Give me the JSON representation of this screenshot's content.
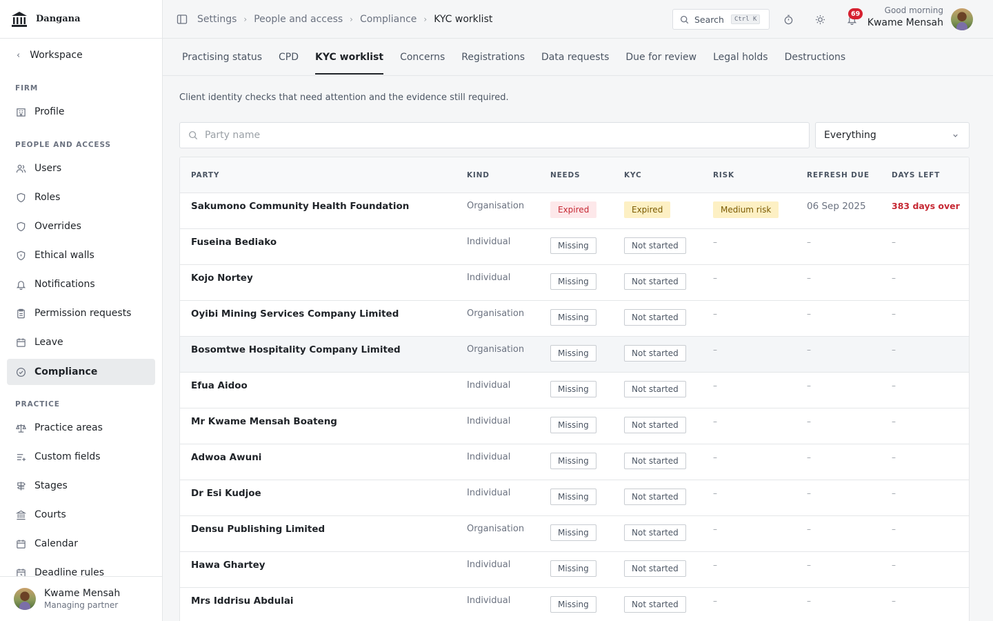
{
  "brand": {
    "name": "Dangana"
  },
  "sidebar": {
    "back_label": "Workspace",
    "sections": [
      {
        "label": "FIRM",
        "items": [
          {
            "label": "Profile",
            "icon": "building-icon"
          }
        ]
      },
      {
        "label": "PEOPLE AND ACCESS",
        "items": [
          {
            "label": "Users",
            "icon": "users-icon"
          },
          {
            "label": "Roles",
            "icon": "shield-icon"
          },
          {
            "label": "Overrides",
            "icon": "shield-icon"
          },
          {
            "label": "Ethical walls",
            "icon": "shield-lock-icon"
          },
          {
            "label": "Notifications",
            "icon": "bell-icon"
          },
          {
            "label": "Permission requests",
            "icon": "clipboard-icon"
          },
          {
            "label": "Leave",
            "icon": "calendar-icon"
          },
          {
            "label": "Compliance",
            "icon": "check-circle-icon",
            "active": true
          }
        ]
      },
      {
        "label": "PRACTICE",
        "items": [
          {
            "label": "Practice areas",
            "icon": "scales-icon"
          },
          {
            "label": "Custom fields",
            "icon": "list-plus-icon"
          },
          {
            "label": "Stages",
            "icon": "signpost-icon"
          },
          {
            "label": "Courts",
            "icon": "landmark-icon"
          },
          {
            "label": "Calendar",
            "icon": "calendar-icon"
          },
          {
            "label": "Deadline rules",
            "icon": "calendar-clock-icon"
          }
        ]
      }
    ],
    "user": {
      "name": "Kwame Mensah",
      "role": "Managing partner"
    }
  },
  "header": {
    "breadcrumb": [
      "Settings",
      "People and access",
      "Compliance",
      "KYC worklist"
    ],
    "search_label": "Search",
    "search_shortcut": "Ctrl K",
    "notification_count": "69",
    "greeting": "Good morning",
    "user_name": "Kwame Mensah"
  },
  "tabs": [
    "Practising status",
    "CPD",
    "KYC worklist",
    "Concerns",
    "Registrations",
    "Data requests",
    "Due for review",
    "Legal holds",
    "Destructions"
  ],
  "active_tab": "KYC worklist",
  "description": "Client identity checks that need attention and the evidence still required.",
  "filters": {
    "search_placeholder": "Party name",
    "scope_value": "Everything"
  },
  "table": {
    "columns": [
      "PARTY",
      "KIND",
      "NEEDS",
      "KYC",
      "RISK",
      "REFRESH DUE",
      "DAYS LEFT"
    ],
    "rows": [
      {
        "party": "Sakumono Community Health Foundation",
        "kind": "Organisation",
        "needs": "Expired",
        "kyc": "Expired",
        "risk": "Medium risk",
        "refresh_due": "06 Sep 2025",
        "days_left": "383 days over"
      },
      {
        "party": "Fuseina Bediako",
        "kind": "Individual",
        "needs": "Missing",
        "kyc": "Not started",
        "risk": "–",
        "refresh_due": "–",
        "days_left": "–"
      },
      {
        "party": "Kojo Nortey",
        "kind": "Individual",
        "needs": "Missing",
        "kyc": "Not started",
        "risk": "–",
        "refresh_due": "–",
        "days_left": "–"
      },
      {
        "party": "Oyibi Mining Services Company Limited",
        "kind": "Organisation",
        "needs": "Missing",
        "kyc": "Not started",
        "risk": "–",
        "refresh_due": "–",
        "days_left": "–"
      },
      {
        "party": "Bosomtwe Hospitality Company Limited",
        "kind": "Organisation",
        "needs": "Missing",
        "kyc": "Not started",
        "risk": "–",
        "refresh_due": "–",
        "days_left": "–"
      },
      {
        "party": "Efua Aidoo",
        "kind": "Individual",
        "needs": "Missing",
        "kyc": "Not started",
        "risk": "–",
        "refresh_due": "–",
        "days_left": "–"
      },
      {
        "party": "Mr Kwame Mensah Boateng",
        "kind": "Individual",
        "needs": "Missing",
        "kyc": "Not started",
        "risk": "–",
        "refresh_due": "–",
        "days_left": "–"
      },
      {
        "party": "Adwoa Awuni",
        "kind": "Individual",
        "needs": "Missing",
        "kyc": "Not started",
        "risk": "–",
        "refresh_due": "–",
        "days_left": "–"
      },
      {
        "party": "Dr Esi Kudjoe",
        "kind": "Individual",
        "needs": "Missing",
        "kyc": "Not started",
        "risk": "–",
        "refresh_due": "–",
        "days_left": "–"
      },
      {
        "party": "Densu Publishing Limited",
        "kind": "Organisation",
        "needs": "Missing",
        "kyc": "Not started",
        "risk": "–",
        "refresh_due": "–",
        "days_left": "–"
      },
      {
        "party": "Hawa Ghartey",
        "kind": "Individual",
        "needs": "Missing",
        "kyc": "Not started",
        "risk": "–",
        "refresh_due": "–",
        "days_left": "–"
      },
      {
        "party": "Mrs Iddrisu Abdulai",
        "kind": "Individual",
        "needs": "Missing",
        "kyc": "Not started",
        "risk": "–",
        "refresh_due": "–",
        "days_left": "–"
      }
    ]
  },
  "colors": {
    "accent": "#1f2328",
    "danger": "#c62833",
    "danger_bg": "#fde8ea",
    "warning_bg": "#fdf0c4",
    "badge": "#d6202f"
  }
}
